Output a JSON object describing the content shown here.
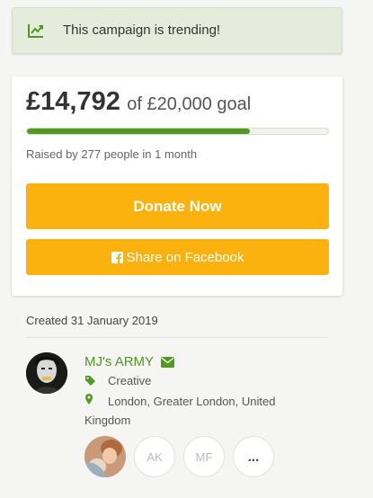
{
  "trending": {
    "icon": "trending-up-icon",
    "text": "This campaign is trending!"
  },
  "fundraiser": {
    "amount": "£14,792",
    "goal_text": "of £20,000 goal",
    "progress_fraction": 0.7396,
    "raised_text": "Raised by 277 people in 1 month",
    "donate_label": "Donate Now",
    "share_label": "Share on Facebook",
    "share_icon": "facebook-icon"
  },
  "details": {
    "created": "Created 31 January 2019",
    "organizer_name": "MJ's ARMY",
    "category": "Creative",
    "location": "London, Greater London, United Kingdom"
  },
  "supporters": {
    "initials": [
      "AK",
      "MF"
    ],
    "more_label": "..."
  },
  "colors": {
    "accent_green": "#4e9a1f",
    "button_yellow": "#fbb20f",
    "banner_bg": "#e5ecdc"
  }
}
